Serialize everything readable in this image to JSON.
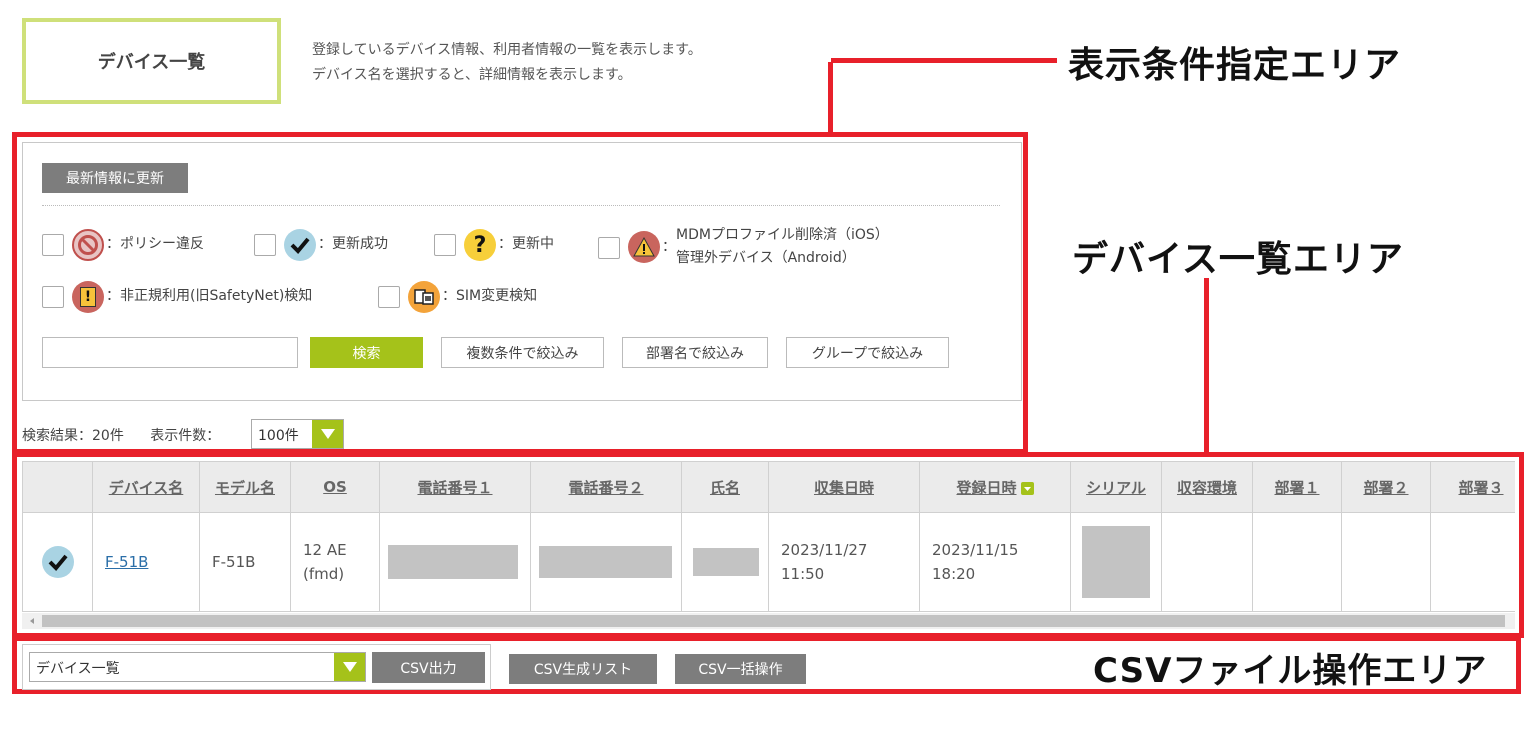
{
  "page": {
    "title": "デバイス一覧",
    "description": [
      "登録しているデバイス情報、利用者情報の一覧を表示します。",
      "デバイス名を選択すると、詳細情報を表示します。"
    ]
  },
  "callouts": {
    "filter_area": "表示条件指定エリア",
    "list_area": "デバイス一覧エリア",
    "csv_area": "CSVファイル操作エリア"
  },
  "filters": {
    "refresh_label": "最新情報に更新",
    "statuses": [
      {
        "icon": "prohibited-icon",
        "label": "：ポリシー違反"
      },
      {
        "icon": "check-icon",
        "label": "：更新成功"
      },
      {
        "icon": "question-icon",
        "label": "：更新中"
      },
      {
        "icon": "warning-icon",
        "label": "：",
        "label_lines": [
          "MDMプロファイル削除済（iOS）",
          "管理外デバイス（Android）"
        ]
      },
      {
        "icon": "alert-icon",
        "label": "：非正規利用(旧SafetyNet)検知"
      },
      {
        "icon": "sim-change-icon",
        "label": "：SIM変更検知"
      }
    ],
    "search_value": "",
    "search_button": "検索",
    "multi_filter_button": "複数条件で絞込み",
    "dept_filter_button": "部署名で絞込み",
    "group_filter_button": "グループで絞込み"
  },
  "results": {
    "count_text": "検索結果：20件",
    "per_page_label": "表示件数：",
    "per_page_value": "100件"
  },
  "table": {
    "columns": [
      "",
      "デバイス名",
      "モデル名",
      "OS",
      "電話番号１",
      "電話番号２",
      "氏名",
      "収集日時",
      "登録日時",
      "シリアル",
      "収容環境",
      "部署１",
      "部署２",
      "部署３"
    ],
    "sorted_column": "登録日時",
    "rows": [
      {
        "status_icon": "check-icon",
        "device_name": "F-51B",
        "model": "F-51B",
        "os_line1": "12 AE",
        "os_line2": "(fmd)",
        "collected_date": "2023/11/27",
        "collected_time": "11:50",
        "registered_date": "2023/11/15",
        "registered_time": "18:20"
      }
    ]
  },
  "csv": {
    "select_value": "デバイス一覧",
    "export_button": "CSV出力",
    "list_button": "CSV生成リスト",
    "bulk_button": "CSV一括操作"
  },
  "colors": {
    "accent_green": "#a5c21a",
    "highlight_red": "#e8202a",
    "title_border": "#cfe07a"
  }
}
